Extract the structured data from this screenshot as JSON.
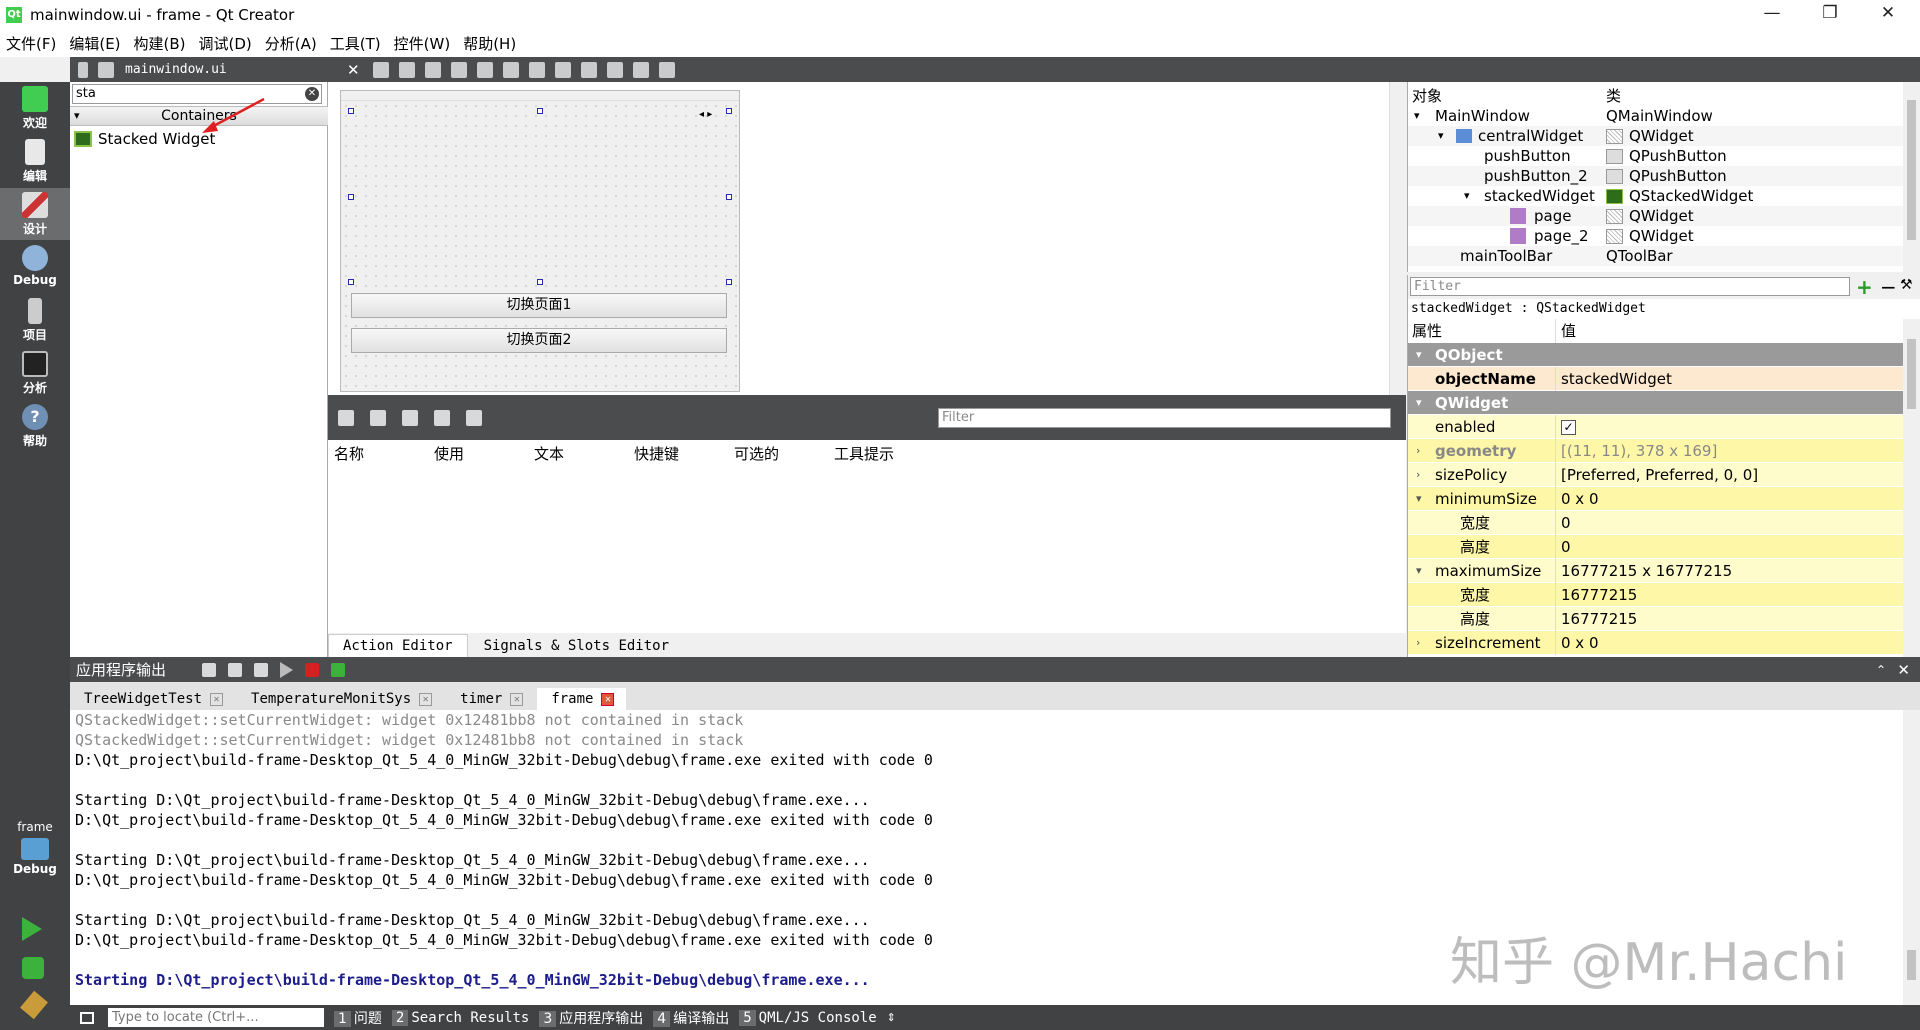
{
  "window": {
    "title": "mainwindow.ui - frame - Qt Creator",
    "logo": "Qt",
    "minimize": "—",
    "restore": "❐",
    "close": "✕"
  },
  "menu": [
    "文件(F)",
    "编辑(E)",
    "构建(B)",
    "调试(D)",
    "分析(A)",
    "工具(T)",
    "控件(W)",
    "帮助(H)"
  ],
  "modes": [
    {
      "label": "欢迎",
      "icon": "qt-logo-icon"
    },
    {
      "label": "编辑",
      "icon": "document-icon"
    },
    {
      "label": "设计",
      "icon": "pencil-icon"
    },
    {
      "label": "Debug",
      "icon": "bug-icon"
    },
    {
      "label": "项目",
      "icon": "wrench-icon"
    },
    {
      "label": "分析",
      "icon": "monitor-icon"
    },
    {
      "label": "帮助",
      "icon": "question-icon"
    }
  ],
  "kit": {
    "project": "frame",
    "label": "Debug"
  },
  "editor_toolbar": {
    "filename": "mainwindow.ui"
  },
  "widget_box": {
    "search": "sta",
    "category": "Containers",
    "item": "Stacked Widget"
  },
  "form": {
    "button1": "切换页面1",
    "button2": "切换页面2",
    "page_nav": "◂ ▸"
  },
  "action_editor": {
    "filter_placeholder": "Filter",
    "columns": [
      "名称",
      "使用",
      "文本",
      "快捷键",
      "可选的",
      "工具提示"
    ],
    "tabs": [
      "Action Editor",
      "Signals & Slots Editor"
    ]
  },
  "object_inspector": {
    "headers": [
      "对象",
      "类"
    ],
    "rows": [
      {
        "name": "MainWindow",
        "class": "QMainWindow"
      },
      {
        "name": "centralWidget",
        "class": "QWidget"
      },
      {
        "name": "pushButton",
        "class": "QPushButton"
      },
      {
        "name": "pushButton_2",
        "class": "QPushButton"
      },
      {
        "name": "stackedWidget",
        "class": "QStackedWidget"
      },
      {
        "name": "page",
        "class": "QWidget"
      },
      {
        "name": "page_2",
        "class": "QWidget"
      },
      {
        "name": "mainToolBar",
        "class": "QToolBar"
      }
    ]
  },
  "property_editor": {
    "filter_placeholder": "Filter",
    "class_line": "stackedWidget : QStackedWidget",
    "headers": [
      "属性",
      "值"
    ],
    "rows": [
      {
        "key": "QObject",
        "value": ""
      },
      {
        "key": "objectName",
        "value": "stackedWidget"
      },
      {
        "key": "QWidget",
        "value": ""
      },
      {
        "key": "enabled",
        "value": "✓"
      },
      {
        "key": "geometry",
        "value": "[(11, 11), 378 x 169]"
      },
      {
        "key": "sizePolicy",
        "value": "[Preferred, Preferred, 0, 0]"
      },
      {
        "key": "minimumSize",
        "value": "0 x 0"
      },
      {
        "key": "宽度",
        "value": "0"
      },
      {
        "key": "高度",
        "value": "0"
      },
      {
        "key": "maximumSize",
        "value": "16777215 x 16777215"
      },
      {
        "key": "宽度",
        "value": "16777215"
      },
      {
        "key": "高度",
        "value": "16777215"
      },
      {
        "key": "sizeIncrement",
        "value": "0 x 0"
      }
    ]
  },
  "output": {
    "title": "应用程序输出",
    "tabs": [
      "TreeWidgetTest",
      "TemperatureMonitSys",
      "timer",
      "frame"
    ],
    "lines": [
      "QStackedWidget::setCurrentWidget: widget 0x12481bb8 not contained in stack",
      "QStackedWidget::setCurrentWidget: widget 0x12481bb8 not contained in stack",
      "D:\\Qt_project\\build-frame-Desktop_Qt_5_4_0_MinGW_32bit-Debug\\debug\\frame.exe exited with code 0",
      "",
      "Starting D:\\Qt_project\\build-frame-Desktop_Qt_5_4_0_MinGW_32bit-Debug\\debug\\frame.exe...",
      "D:\\Qt_project\\build-frame-Desktop_Qt_5_4_0_MinGW_32bit-Debug\\debug\\frame.exe exited with code 0",
      "",
      "Starting D:\\Qt_project\\build-frame-Desktop_Qt_5_4_0_MinGW_32bit-Debug\\debug\\frame.exe...",
      "D:\\Qt_project\\build-frame-Desktop_Qt_5_4_0_MinGW_32bit-Debug\\debug\\frame.exe exited with code 0",
      "",
      "Starting D:\\Qt_project\\build-frame-Desktop_Qt_5_4_0_MinGW_32bit-Debug\\debug\\frame.exe...",
      "D:\\Qt_project\\build-frame-Desktop_Qt_5_4_0_MinGW_32bit-Debug\\debug\\frame.exe exited with code 0",
      "",
      "Starting D:\\Qt_project\\build-frame-Desktop_Qt_5_4_0_MinGW_32bit-Debug\\debug\\frame.exe..."
    ]
  },
  "watermark": "知乎 @Mr.Hachi",
  "statusbar": {
    "locate_placeholder": "Type to locate (Ctrl+...",
    "panes": [
      {
        "num": "1",
        "label": "问题"
      },
      {
        "num": "2",
        "label": "Search Results"
      },
      {
        "num": "3",
        "label": "应用程序输出"
      },
      {
        "num": "4",
        "label": "编译输出"
      },
      {
        "num": "5",
        "label": "QML/JS Console"
      }
    ]
  },
  "colors": {
    "mode_bar": "#404244",
    "toolbar": "#4a4c4e",
    "property_group": "#9a9a9a",
    "property_yellow": "#fffccc",
    "property_pink": "#fde9d0",
    "output_blue": "#1c1c8c"
  }
}
